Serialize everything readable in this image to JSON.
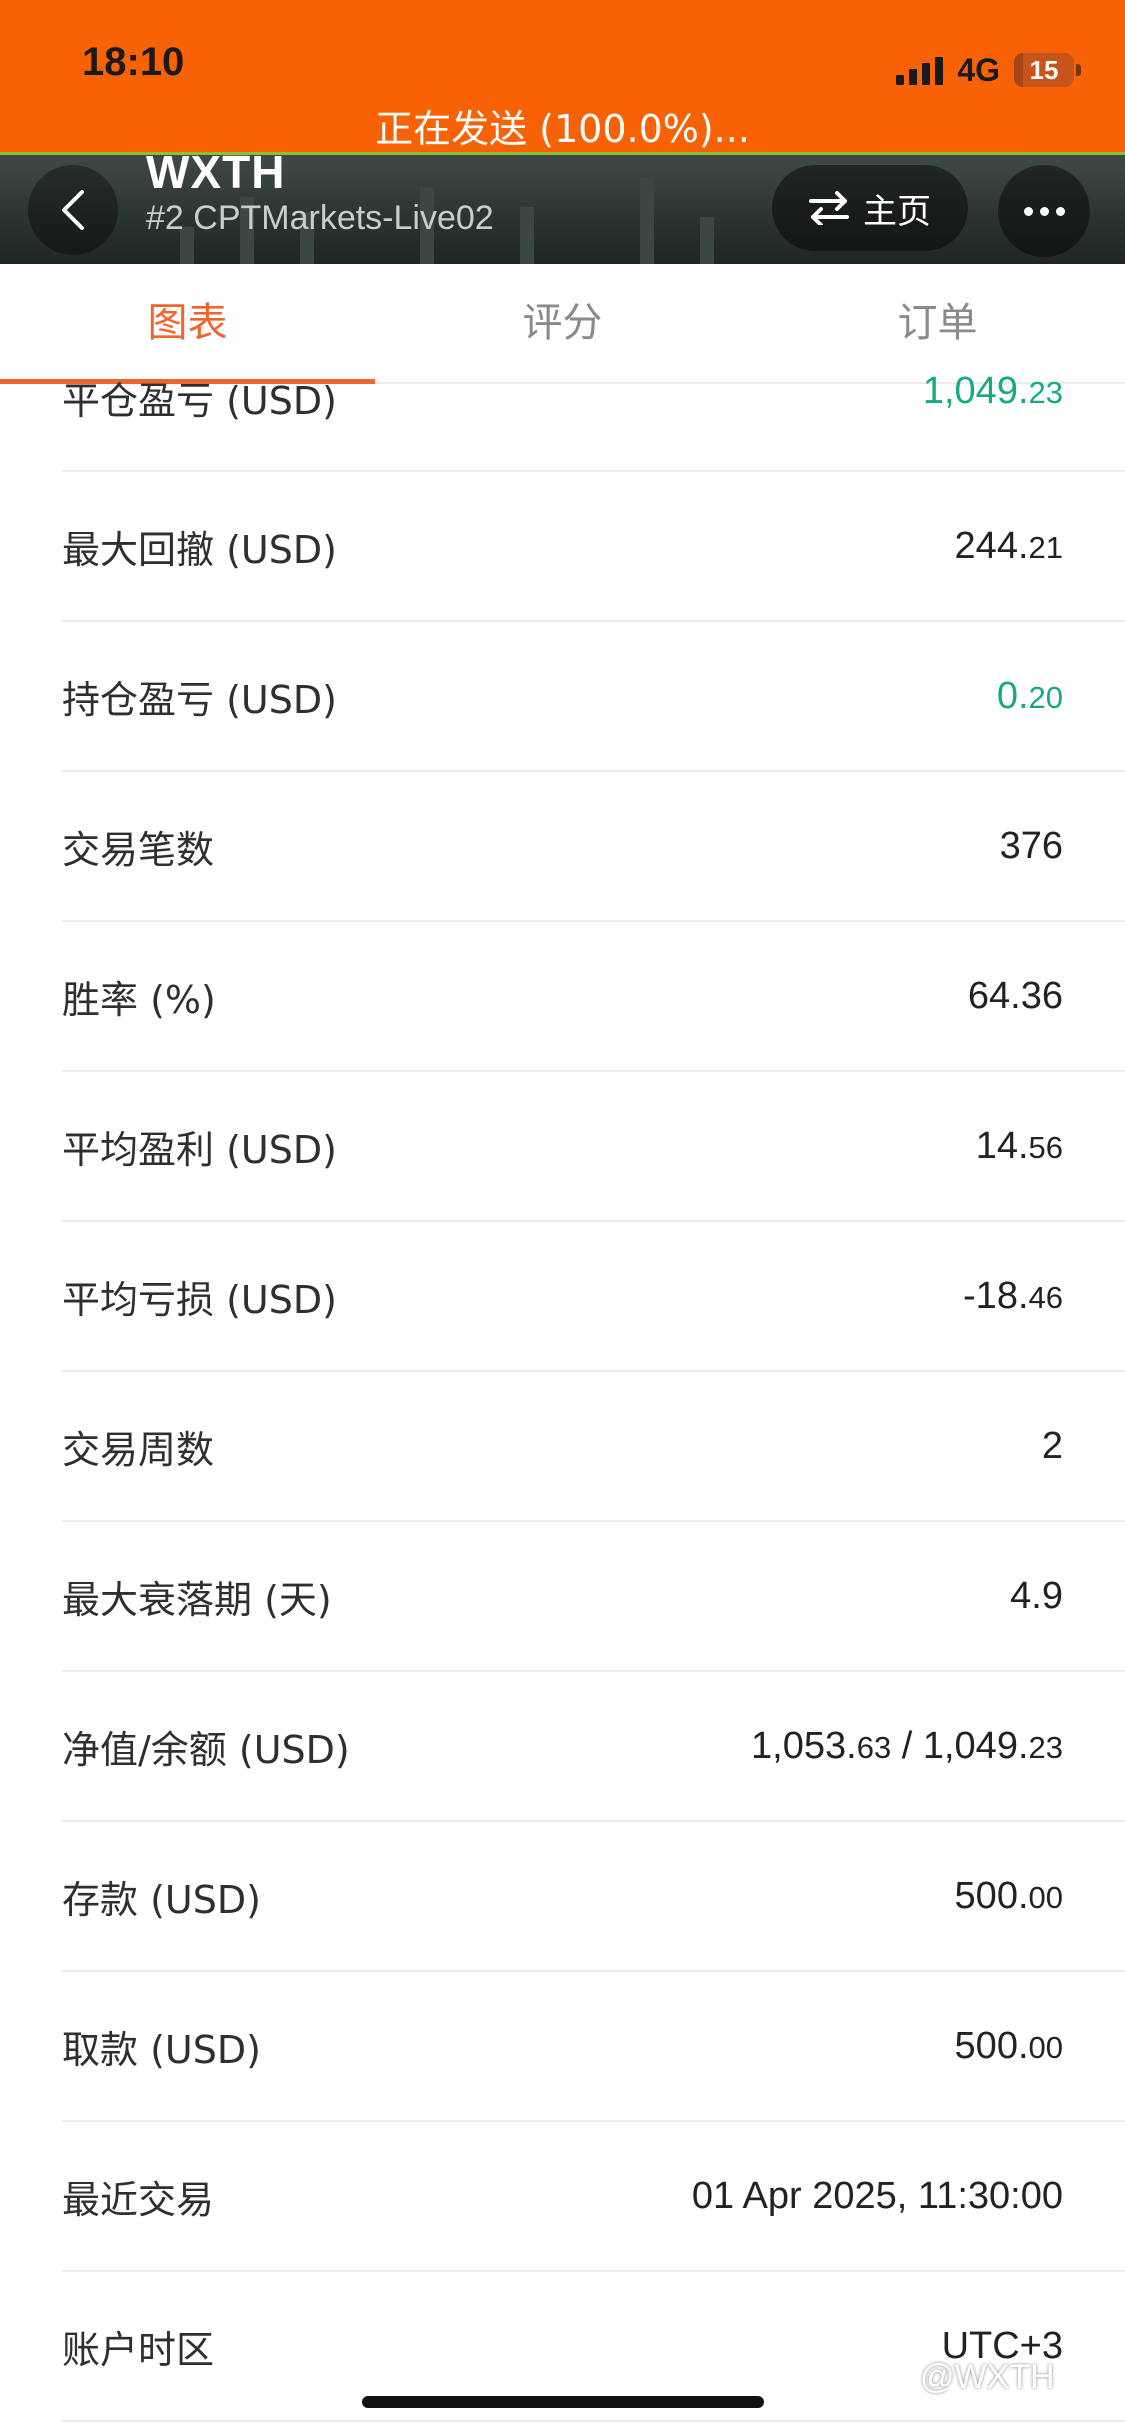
{
  "status_bar": {
    "time": "18:10",
    "network": "4G",
    "battery": "15",
    "sending_text": "正在发送 (100.0%)..."
  },
  "header": {
    "account_name": "WXTH",
    "server": "#2 CPTMarkets-Live02",
    "home_label": "主页",
    "icons": [
      "chevron-left-icon",
      "swap-icon",
      "more-dots-icon"
    ]
  },
  "tabs": [
    {
      "label": "图表",
      "active": true
    },
    {
      "label": "评分",
      "active": false
    },
    {
      "label": "订单",
      "active": false
    }
  ],
  "rows": [
    {
      "label": "平仓盈亏 (USD)",
      "int": "1,049.",
      "dec": "23",
      "color": "#17a983"
    },
    {
      "label": "最大回撤 (USD)",
      "int": "244.",
      "dec": "21"
    },
    {
      "label": "持仓盈亏 (USD)",
      "int": "0.",
      "dec": "20",
      "color": "#17a983"
    },
    {
      "label": "交易笔数",
      "int": "376",
      "dec": ""
    },
    {
      "label": "胜率 (%)",
      "int": "64.36",
      "dec": ""
    },
    {
      "label": "平均盈利 (USD)",
      "int": "14.",
      "dec": "56"
    },
    {
      "label": "平均亏损 (USD)",
      "int": "-18.",
      "dec": "46"
    },
    {
      "label": "交易周数",
      "int": "2",
      "dec": ""
    },
    {
      "label": "最大衰落期 (天)",
      "int": "4.9",
      "dec": ""
    },
    {
      "label": "净值/余额 (USD)",
      "int": "1,053.",
      "dec": "63",
      "int2": " / 1,049.",
      "dec2": "23"
    },
    {
      "label": "存款 (USD)",
      "int": "500.",
      "dec": "00"
    },
    {
      "label": "取款 (USD)",
      "int": "500.",
      "dec": "00"
    },
    {
      "label": "最近交易",
      "int": "01 Apr 2025, 11:30:00",
      "dec": ""
    },
    {
      "label": "账户时区",
      "int": "UTC+3",
      "dec": ""
    }
  ],
  "watermark": "@WXTH",
  "colors": {
    "status_bar": "#f86207",
    "accent": "#f0652b",
    "positive": "#17a983"
  }
}
